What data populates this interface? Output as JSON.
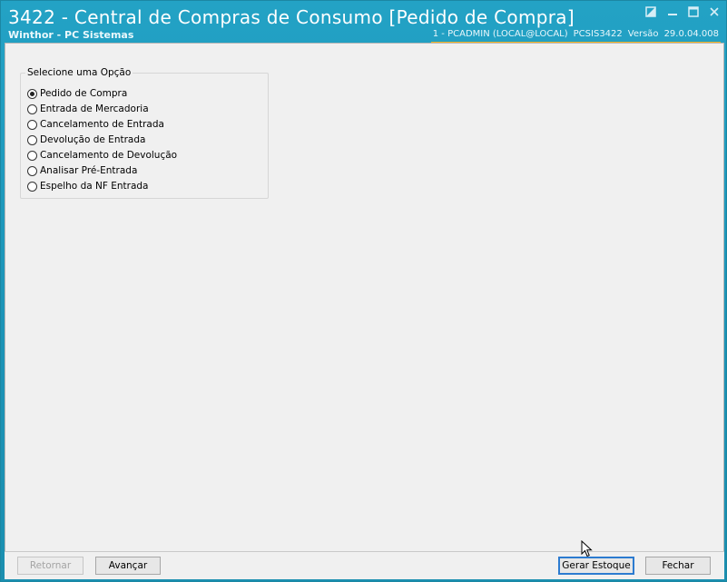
{
  "window": {
    "title": "3422 - Central de Compras de Consumo [Pedido de Compra]",
    "subtitle": "Winthor - PC Sistemas",
    "session": "1 - PCADMIN (LOCAL@LOCAL)",
    "program": "PCSIS3422",
    "version_label": "Versão",
    "version": "29.0.04.008"
  },
  "options_group": {
    "title": "Selecione uma Opção",
    "selected_index": 0,
    "items": [
      "Pedido de Compra",
      "Entrada de Mercadoria",
      "Cancelamento de Entrada",
      "Devolução de Entrada",
      "Cancelamento de Devolução",
      "Analisar Pré-Entrada",
      "Espelho da NF Entrada"
    ]
  },
  "buttons": {
    "back": "Retornar",
    "next": "Avançar",
    "generate_stock": "Gerar Estoque",
    "close": "Fechar"
  },
  "colors": {
    "titlebar": "#1c93b6",
    "session_underline": "#f3b324",
    "focus_border": "#2c7bd0"
  }
}
